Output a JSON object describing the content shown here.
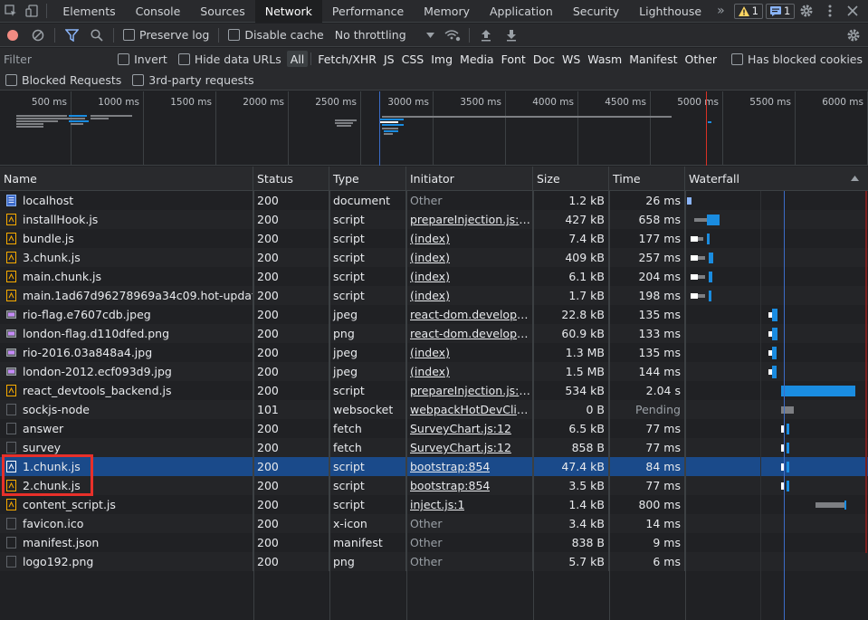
{
  "tabs": [
    "Elements",
    "Console",
    "Sources",
    "Network",
    "Performance",
    "Memory",
    "Application",
    "Security",
    "Lighthouse"
  ],
  "active_tab": "Network",
  "more_tabs_label": "»",
  "warnings_count": "1",
  "messages_count": "1",
  "toolbar": {
    "preserve_log": "Preserve log",
    "disable_cache": "Disable cache",
    "throttling": "No throttling"
  },
  "filter": {
    "placeholder": "Filter",
    "invert": "Invert",
    "hide_data_urls": "Hide data URLs",
    "types": [
      "All",
      "Fetch/XHR",
      "JS",
      "CSS",
      "Img",
      "Media",
      "Font",
      "Doc",
      "WS",
      "Wasm",
      "Manifest",
      "Other"
    ],
    "active_type": "All",
    "has_blocked_cookies": "Has blocked cookies",
    "blocked_requests": "Blocked Requests",
    "third_party": "3rd-party requests"
  },
  "overview_ticks": [
    "500 ms",
    "1000 ms",
    "1500 ms",
    "2000 ms",
    "2500 ms",
    "3000 ms",
    "3500 ms",
    "4000 ms",
    "4500 ms",
    "5000 ms",
    "5500 ms",
    "6000 ms"
  ],
  "columns": {
    "name": "Name",
    "status": "Status",
    "type": "Type",
    "initiator": "Initiator",
    "size": "Size",
    "time": "Time",
    "waterfall": "Waterfall"
  },
  "rows": [
    {
      "name": "localhost",
      "icon": "document-icon",
      "status": "200",
      "type": "document",
      "initiator": "Other",
      "initiator_link": false,
      "size": "1.2 kB",
      "time": "26 ms"
    },
    {
      "name": "installHook.js",
      "icon": "script-icon",
      "status": "200",
      "type": "script",
      "initiator": "prepareInjection.js:525",
      "initiator_link": true,
      "size": "427 kB",
      "time": "658 ms"
    },
    {
      "name": "bundle.js",
      "icon": "script-icon",
      "status": "200",
      "type": "script",
      "initiator": "(index)",
      "initiator_link": true,
      "size": "7.4 kB",
      "time": "177 ms"
    },
    {
      "name": "3.chunk.js",
      "icon": "script-icon",
      "status": "200",
      "type": "script",
      "initiator": "(index)",
      "initiator_link": true,
      "size": "409 kB",
      "time": "257 ms"
    },
    {
      "name": "main.chunk.js",
      "icon": "script-icon",
      "status": "200",
      "type": "script",
      "initiator": "(index)",
      "initiator_link": true,
      "size": "6.1 kB",
      "time": "204 ms"
    },
    {
      "name": "main.1ad67d96278969a34c09.hot-update.js",
      "icon": "script-icon",
      "status": "200",
      "type": "script",
      "initiator": "(index)",
      "initiator_link": true,
      "size": "1.7 kB",
      "time": "198 ms"
    },
    {
      "name": "rio-flag.e7607cdb.jpeg",
      "icon": "image-icon",
      "status": "200",
      "type": "jpeg",
      "initiator": "react-dom.developme…",
      "initiator_link": true,
      "size": "22.8 kB",
      "time": "135 ms"
    },
    {
      "name": "london-flag.d110dfed.png",
      "icon": "image-icon",
      "status": "200",
      "type": "png",
      "initiator": "react-dom.developme…",
      "initiator_link": true,
      "size": "60.9 kB",
      "time": "133 ms"
    },
    {
      "name": "rio-2016.03a848a4.jpg",
      "icon": "image-icon",
      "status": "200",
      "type": "jpeg",
      "initiator": "(index)",
      "initiator_link": true,
      "size": "1.3 MB",
      "time": "135 ms"
    },
    {
      "name": "london-2012.ecf093d9.jpg",
      "icon": "image-icon",
      "status": "200",
      "type": "jpeg",
      "initiator": "(index)",
      "initiator_link": true,
      "size": "1.5 MB",
      "time": "144 ms"
    },
    {
      "name": "react_devtools_backend.js",
      "icon": "script-icon",
      "status": "200",
      "type": "script",
      "initiator": "prepareInjection.js:525",
      "initiator_link": true,
      "size": "534 kB",
      "time": "2.04 s"
    },
    {
      "name": "sockjs-node",
      "icon": "none",
      "status": "101",
      "type": "websocket",
      "initiator": "webpackHotDevClien…",
      "initiator_link": true,
      "size": "0 B",
      "time": "Pending"
    },
    {
      "name": "answer",
      "icon": "none",
      "status": "200",
      "type": "fetch",
      "initiator": "SurveyChart.js:12",
      "initiator_link": true,
      "size": "6.5 kB",
      "time": "77 ms"
    },
    {
      "name": "survey",
      "icon": "none",
      "status": "200",
      "type": "fetch",
      "initiator": "SurveyChart.js:12",
      "initiator_link": true,
      "size": "858 B",
      "time": "77 ms"
    },
    {
      "name": "1.chunk.js",
      "icon": "script-icon",
      "status": "200",
      "type": "script",
      "initiator": "bootstrap:854",
      "initiator_link": true,
      "size": "47.4 kB",
      "time": "84 ms"
    },
    {
      "name": "2.chunk.js",
      "icon": "script-icon",
      "status": "200",
      "type": "script",
      "initiator": "bootstrap:854",
      "initiator_link": true,
      "size": "3.5 kB",
      "time": "77 ms"
    },
    {
      "name": "content_script.js",
      "icon": "script-icon",
      "status": "200",
      "type": "script",
      "initiator": "inject.js:1",
      "initiator_link": true,
      "size": "1.4 kB",
      "time": "800 ms"
    },
    {
      "name": "favicon.ico",
      "icon": "none",
      "status": "200",
      "type": "x-icon",
      "initiator": "Other",
      "initiator_link": false,
      "size": "3.4 kB",
      "time": "14 ms"
    },
    {
      "name": "manifest.json",
      "icon": "none",
      "status": "200",
      "type": "manifest",
      "initiator": "Other",
      "initiator_link": false,
      "size": "838 B",
      "time": "9 ms"
    },
    {
      "name": "logo192.png",
      "icon": "none",
      "status": "200",
      "type": "png",
      "initiator": "Other",
      "initiator_link": false,
      "size": "5.7 kB",
      "time": "6 ms"
    }
  ],
  "selected_row": "1.chunk.js",
  "colors": {
    "accent": "#8ab4f8",
    "record_red": "#f28b82",
    "selected_row": "#1a4a8a",
    "waterfall_bar": "#1a8ce0",
    "highlight": "#e8302a"
  }
}
